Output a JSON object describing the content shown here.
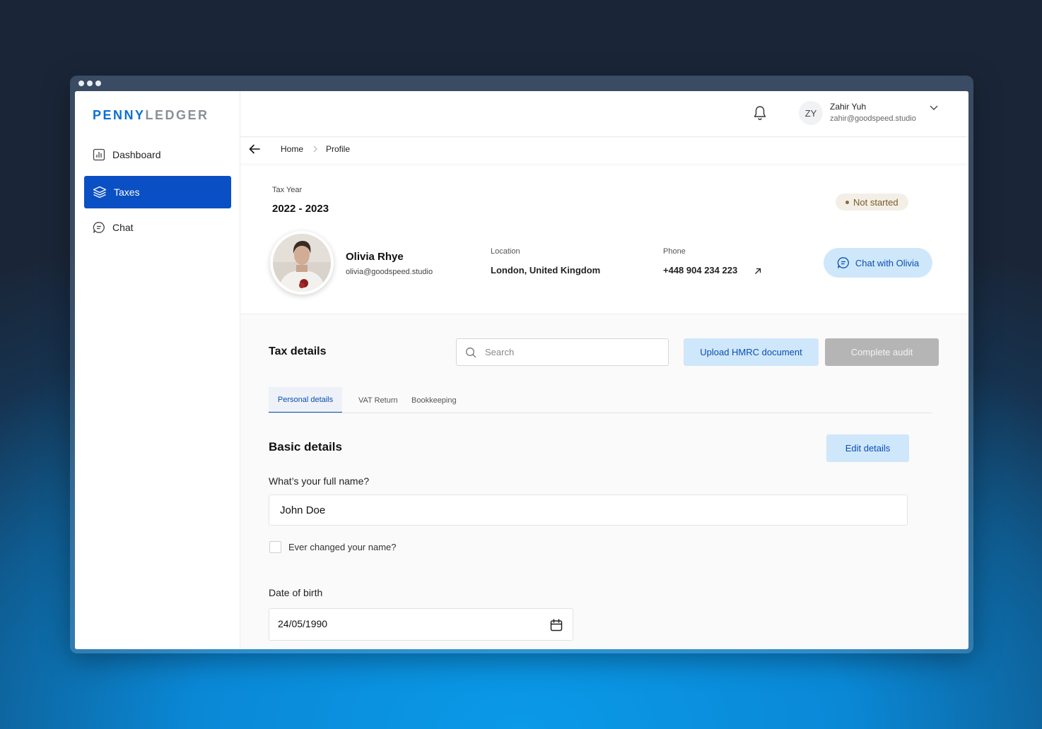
{
  "brand": {
    "part1": "PENNY",
    "part2": "LEDGER"
  },
  "sidebar": {
    "items": [
      {
        "label": "Dashboard",
        "icon": "chart-icon"
      },
      {
        "label": "Taxes",
        "icon": "layers-icon",
        "active": true
      },
      {
        "label": "Chat",
        "icon": "chat-icon"
      }
    ]
  },
  "user": {
    "initials": "ZY",
    "name": "Zahir Yuh",
    "email": "zahir@goodspeed.studio"
  },
  "breadcrumb": {
    "home": "Home",
    "current": "Profile"
  },
  "profile": {
    "tax_year_label": "Tax Year",
    "tax_year": "2022 - 2023",
    "status": "Not started",
    "name": "Olivia Rhye",
    "email": "olivia@goodspeed.studio",
    "location_label": "Location",
    "location": "London, United Kingdom",
    "phone_label": "Phone",
    "phone": "+448 904 234 223",
    "chat_button": "Chat with Olivia"
  },
  "tax_details": {
    "title": "Tax details",
    "search_placeholder": "Search",
    "upload_button": "Upload HMRC document",
    "audit_button": "Complete audit",
    "tabs": [
      {
        "label": "Personal details",
        "active": true
      },
      {
        "label": "VAT Return"
      },
      {
        "label": "Bookkeeping"
      }
    ]
  },
  "basic_details": {
    "title": "Basic details",
    "edit_button": "Edit details",
    "full_name_label": "What’s your full name?",
    "full_name_value": "John Doe",
    "changed_name_label": "Ever changed your name?",
    "dob_label": "Date of birth",
    "dob_value": "24/05/1990"
  },
  "colors": {
    "primary": "#0a4fc4",
    "brand_blue": "#0a6fd1",
    "light_blue": "#cfe7fb",
    "badge_bg": "#f3efe6"
  }
}
